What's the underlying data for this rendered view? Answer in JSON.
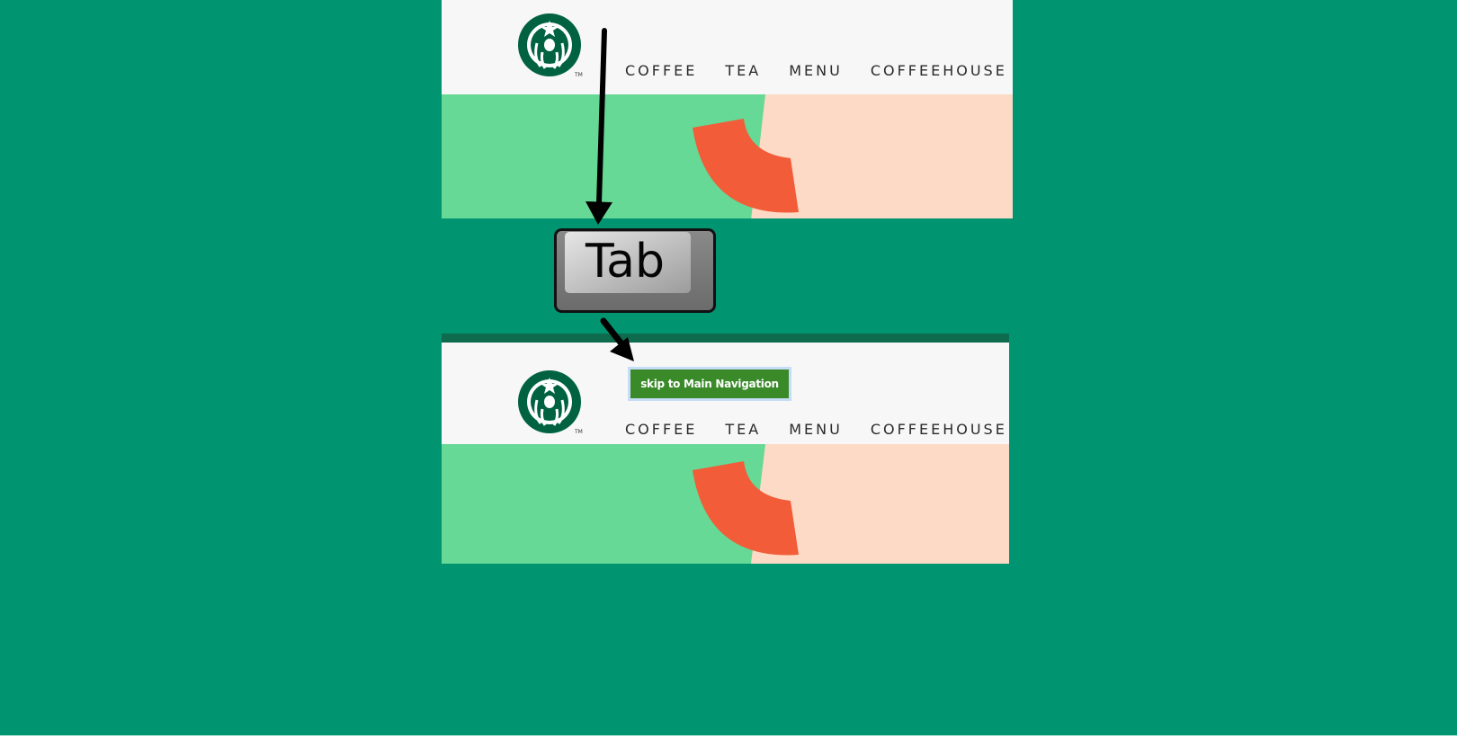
{
  "colors": {
    "page_background": "#009470",
    "header_background": "#f7f7f7",
    "hero_green": "#66d996",
    "hero_peach": "#fddac6",
    "hero_shape": "#f25c38",
    "brand_green": "#006241",
    "skip_link_background": "#3a8a2a",
    "focus_outline": "#c7dcf6",
    "focus_strip": "#0e6b4d"
  },
  "icons": {
    "logo": "starbucks-siren-logo",
    "arrow": "black-arrow",
    "key": "keyboard-key"
  },
  "before_screenshot": {
    "nav_items": [
      "COFFEE",
      "TEA",
      "MENU",
      "COFFEEHOUSE"
    ]
  },
  "keyboard_key": {
    "label": "Tab"
  },
  "after_screenshot": {
    "skip_link_label": "skip to Main Navigation",
    "nav_items": [
      "COFFEE",
      "TEA",
      "MENU",
      "COFFEEHOUSE"
    ]
  }
}
